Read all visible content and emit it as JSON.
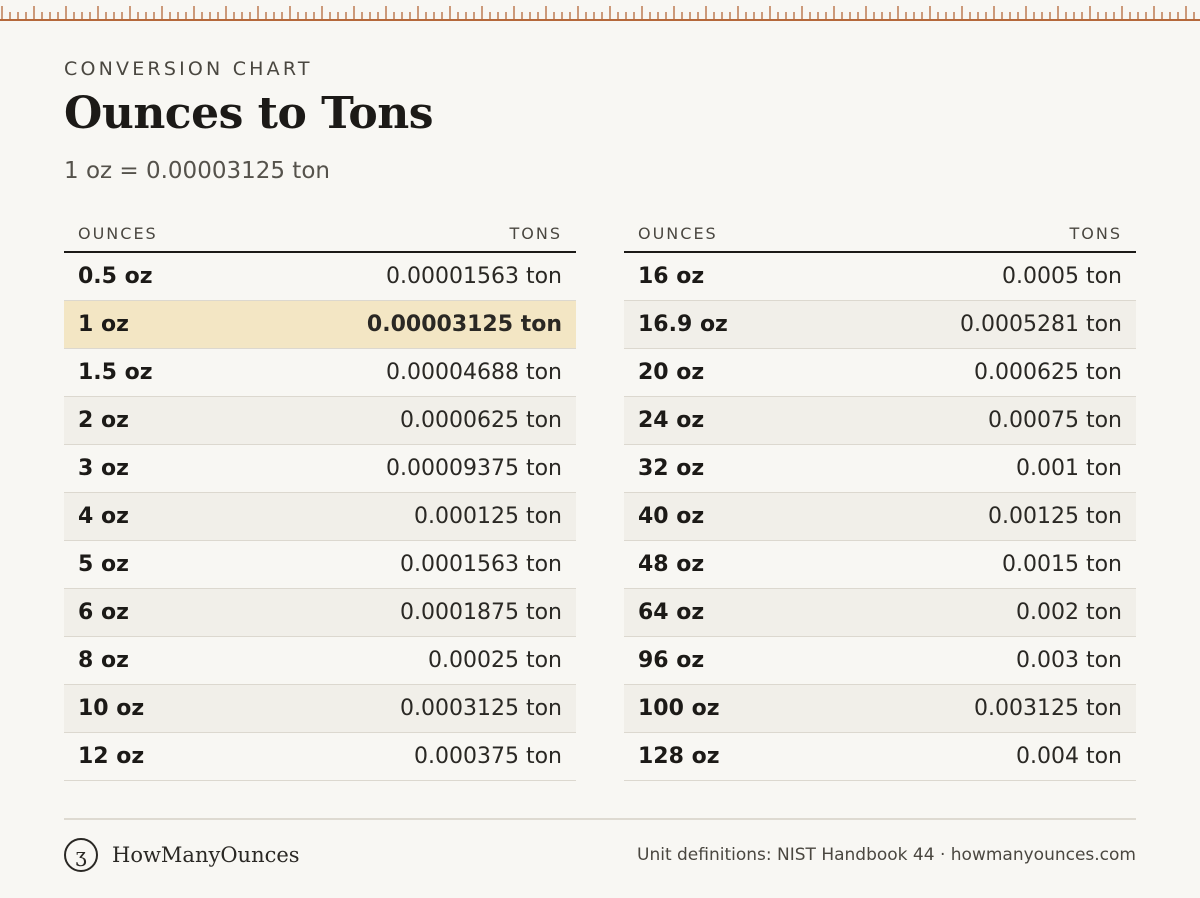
{
  "header": {
    "eyebrow": "CONVERSION CHART",
    "title": "Ounces to Tons",
    "subtitle": "1 oz = 0.00003125 ton"
  },
  "columns": {
    "ounces": "OUNCES",
    "tons": "TONS"
  },
  "left_rows": [
    {
      "oz": "0.5 oz",
      "ton": "0.00001563 ton",
      "highlight": false
    },
    {
      "oz": "1 oz",
      "ton": "0.00003125 ton",
      "highlight": true
    },
    {
      "oz": "1.5 oz",
      "ton": "0.00004688 ton",
      "highlight": false
    },
    {
      "oz": "2 oz",
      "ton": "0.0000625 ton",
      "highlight": false
    },
    {
      "oz": "3 oz",
      "ton": "0.00009375 ton",
      "highlight": false
    },
    {
      "oz": "4 oz",
      "ton": "0.000125 ton",
      "highlight": false
    },
    {
      "oz": "5 oz",
      "ton": "0.0001563 ton",
      "highlight": false
    },
    {
      "oz": "6 oz",
      "ton": "0.0001875 ton",
      "highlight": false
    },
    {
      "oz": "8 oz",
      "ton": "0.00025 ton",
      "highlight": false
    },
    {
      "oz": "10 oz",
      "ton": "0.0003125 ton",
      "highlight": false
    },
    {
      "oz": "12 oz",
      "ton": "0.000375 ton",
      "highlight": false
    }
  ],
  "right_rows": [
    {
      "oz": "16 oz",
      "ton": "0.0005 ton",
      "highlight": false
    },
    {
      "oz": "16.9 oz",
      "ton": "0.0005281 ton",
      "highlight": false
    },
    {
      "oz": "20 oz",
      "ton": "0.000625 ton",
      "highlight": false
    },
    {
      "oz": "24 oz",
      "ton": "0.00075 ton",
      "highlight": false
    },
    {
      "oz": "32 oz",
      "ton": "0.001 ton",
      "highlight": false
    },
    {
      "oz": "40 oz",
      "ton": "0.00125 ton",
      "highlight": false
    },
    {
      "oz": "48 oz",
      "ton": "0.0015 ton",
      "highlight": false
    },
    {
      "oz": "64 oz",
      "ton": "0.002 ton",
      "highlight": false
    },
    {
      "oz": "96 oz",
      "ton": "0.003 ton",
      "highlight": false
    },
    {
      "oz": "100 oz",
      "ton": "0.003125 ton",
      "highlight": false
    },
    {
      "oz": "128 oz",
      "ton": "0.004 ton",
      "highlight": false
    }
  ],
  "footer": {
    "logo_glyph": "ʒ",
    "brand": "HowManyOunces",
    "credit": "Unit definitions: NIST Handbook 44 · howmanyounces.com"
  },
  "colors": {
    "ruler": "#b5683a",
    "background": "#f8f7f3",
    "highlight": "#f3e6c4"
  }
}
